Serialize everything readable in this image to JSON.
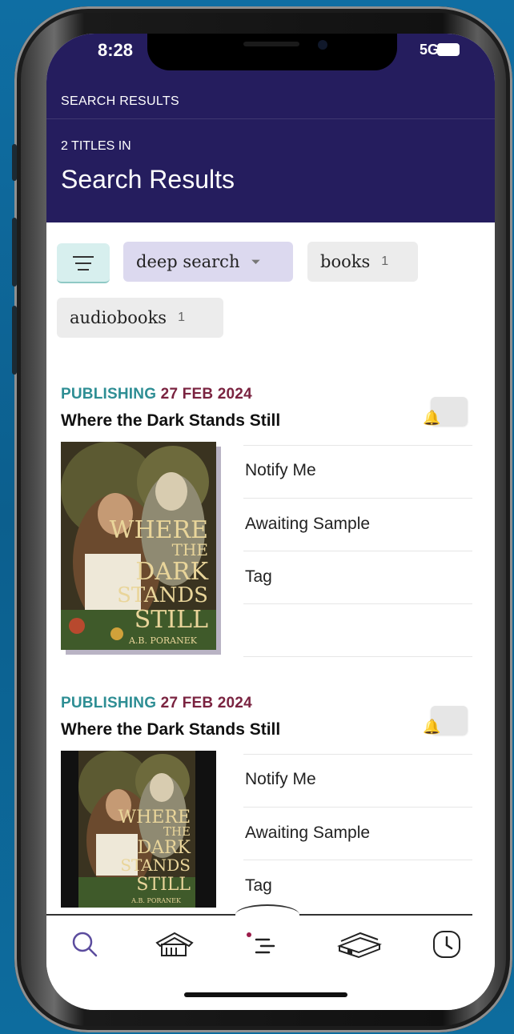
{
  "status": {
    "time": "8:28",
    "network": "5G"
  },
  "header": {
    "breadcrumb": "SEARCH RESULTS",
    "count": "2 TITLES IN",
    "title": "Search Results"
  },
  "filters": {
    "deep_search": "deep search",
    "books": {
      "label": "books",
      "count": "1"
    },
    "audiobooks": {
      "label": "audiobooks",
      "count": "1"
    }
  },
  "results": [
    {
      "publishing_label": "PUBLISHING",
      "date": "27 FEB 2024",
      "title": "Where the Dark Stands Still",
      "actions": [
        "Notify Me",
        "Awaiting Sample",
        "Tag"
      ],
      "cover": {
        "line1": "WHERE",
        "line2": "THE",
        "line3": "DARK",
        "line4": "STANDS",
        "line5": "STILL",
        "author": "A.B. PORANEK"
      }
    },
    {
      "publishing_label": "PUBLISHING",
      "date": "27 FEB 2024",
      "title": "Where the Dark Stands Still",
      "actions": [
        "Notify Me",
        "Awaiting Sample",
        "Tag"
      ],
      "cover": {
        "line1": "WHERE",
        "line2": "THE",
        "line3": "DARK",
        "line4": "STANDS",
        "line5": "STILL",
        "author": "A.B. PORANEK"
      }
    }
  ],
  "tabbar": [
    "search-icon",
    "library-icon",
    "menu-icon",
    "books-icon",
    "clock-icon"
  ],
  "colors": {
    "header": "#251d5e",
    "teal": "#2e8e94",
    "date": "#7a2340",
    "chip_deep": "#dcd9ef",
    "chip_gray": "#ececec"
  }
}
